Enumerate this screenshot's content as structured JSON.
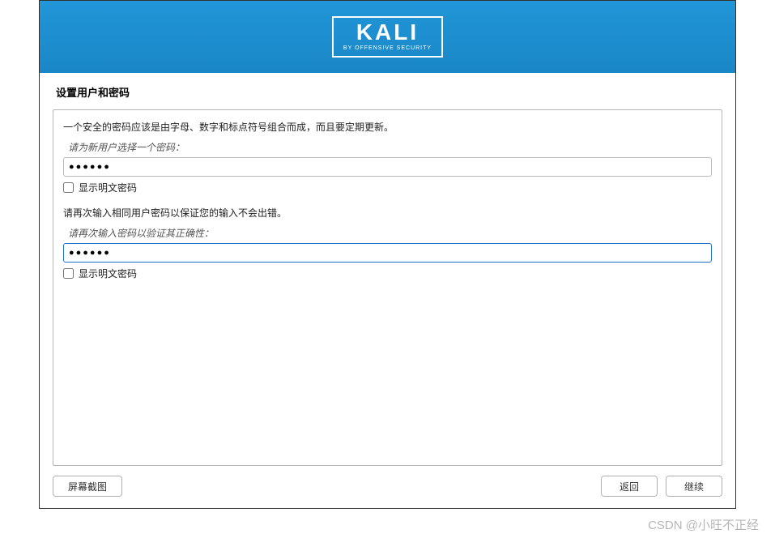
{
  "header": {
    "logo_text": "KALI",
    "logo_subtext": "BY OFFENSIVE SECURITY"
  },
  "page": {
    "title": "设置用户和密码"
  },
  "content": {
    "password_tip": "一个安全的密码应该是由字母、数字和标点符号组合而成，而且要定期更新。",
    "password_label": "请为新用户选择一个密码：",
    "password_value": "●●●●●●",
    "show_password1_label": "显示明文密码",
    "confirm_tip": "请再次输入相同用户密码以保证您的输入不会出错。",
    "confirm_label": "请再次输入密码以验证其正确性：",
    "confirm_value": "●●●●●●",
    "show_password2_label": "显示明文密码"
  },
  "footer": {
    "screenshot_label": "屏幕截图",
    "back_label": "返回",
    "continue_label": "继续"
  },
  "watermark": "CSDN @小旺不正经"
}
